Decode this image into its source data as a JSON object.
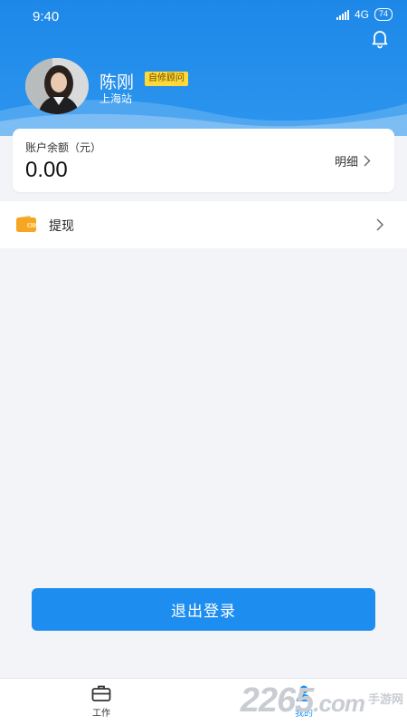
{
  "status_bar": {
    "time": "9:40",
    "network": "4G",
    "battery": "74"
  },
  "profile": {
    "name": "陈刚",
    "badge": "自修顾问",
    "station": "上海站"
  },
  "balance": {
    "label": "账户余额（元）",
    "value": "0.00",
    "detail_link": "明细"
  },
  "menu": {
    "withdraw_label": "提现"
  },
  "logout_label": "退出登录",
  "tabbar": {
    "work_label": "工作",
    "mine_label": "我的",
    "active": "mine"
  },
  "watermark": {
    "number": "2265",
    "suffix": ".com",
    "site": "手游网"
  },
  "colors": {
    "primary": "#1d8ef0",
    "header": "#1e88e9",
    "badge": "#ffd93a",
    "wallet": "#f5a623"
  },
  "icons": {
    "bell": "bell-icon",
    "wallet": "wallet-icon",
    "work": "briefcase-icon",
    "mine": "person-icon"
  }
}
